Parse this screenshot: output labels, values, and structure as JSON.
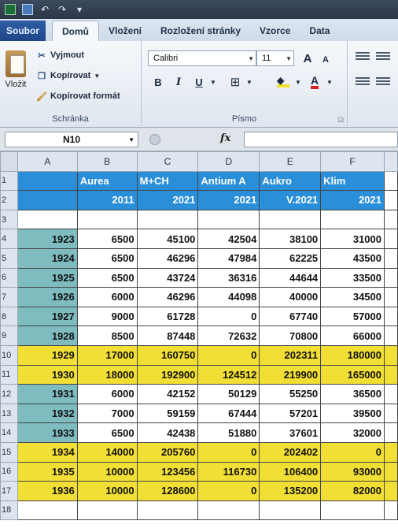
{
  "qat": {
    "undo": "↶",
    "redo": "↷"
  },
  "tabs": [
    "Soubor",
    "Domů",
    "Vložení",
    "Rozložení stránky",
    "Vzorce",
    "Data"
  ],
  "ribbon": {
    "clipboard": {
      "paste_label": "Vložit",
      "cut_label": "Vyjmout",
      "copy_label": "Kopírovat",
      "format_painter_label": "Kopírovat formát",
      "group_label": "Schránka"
    },
    "font": {
      "font_name": "Calibri",
      "font_size": "11",
      "grow_label": "A",
      "shrink_label": "A",
      "bold_label": "B",
      "italic_label": "I",
      "underline_label": "U",
      "group_label": "Písmo"
    }
  },
  "formula_bar": {
    "name_box": "N10",
    "fx_label": "fx",
    "formula": ""
  },
  "grid": {
    "columns": [
      "A",
      "B",
      "C",
      "D",
      "E",
      "F"
    ],
    "header_row1": [
      "",
      "Aurea",
      "M+CH",
      "Antium A",
      "Aukro",
      "Klim"
    ],
    "header_row2": [
      "",
      "2011",
      "2021",
      "2021",
      "V.2021",
      "2021"
    ],
    "rows": [
      {
        "n": "4",
        "cells": [
          "1923",
          "6500",
          "45100",
          "42504",
          "38100",
          "31000"
        ],
        "yellow": false
      },
      {
        "n": "5",
        "cells": [
          "1924",
          "6500",
          "46296",
          "47984",
          "62225",
          "43500"
        ],
        "yellow": false
      },
      {
        "n": "6",
        "cells": [
          "1925",
          "6500",
          "43724",
          "36316",
          "44644",
          "33500"
        ],
        "yellow": false
      },
      {
        "n": "7",
        "cells": [
          "1926",
          "6000",
          "46296",
          "44098",
          "40000",
          "34500"
        ],
        "yellow": false
      },
      {
        "n": "8",
        "cells": [
          "1927",
          "9000",
          "61728",
          "0",
          "67740",
          "57000"
        ],
        "yellow": false
      },
      {
        "n": "9",
        "cells": [
          "1928",
          "8500",
          "87448",
          "72632",
          "70800",
          "66000"
        ],
        "yellow": false
      },
      {
        "n": "10",
        "cells": [
          "1929",
          "17000",
          "160750",
          "0",
          "202311",
          "180000"
        ],
        "yellow": true
      },
      {
        "n": "11",
        "cells": [
          "1930",
          "18000",
          "192900",
          "124512",
          "219900",
          "165000"
        ],
        "yellow": true
      },
      {
        "n": "12",
        "cells": [
          "1931",
          "6000",
          "42152",
          "50129",
          "55250",
          "36500"
        ],
        "yellow": false
      },
      {
        "n": "13",
        "cells": [
          "1932",
          "7000",
          "59159",
          "67444",
          "57201",
          "39500"
        ],
        "yellow": false
      },
      {
        "n": "14",
        "cells": [
          "1933",
          "6500",
          "42438",
          "51880",
          "37601",
          "32000"
        ],
        "yellow": false
      },
      {
        "n": "15",
        "cells": [
          "1934",
          "14000",
          "205760",
          "0",
          "202402",
          "0"
        ],
        "yellow": true
      },
      {
        "n": "16",
        "cells": [
          "1935",
          "10000",
          "123456",
          "116730",
          "106400",
          "93000"
        ],
        "yellow": true
      },
      {
        "n": "17",
        "cells": [
          "1936",
          "10000",
          "128600",
          "0",
          "135200",
          "82000"
        ],
        "yellow": true
      }
    ],
    "empty_row_label": "18"
  }
}
